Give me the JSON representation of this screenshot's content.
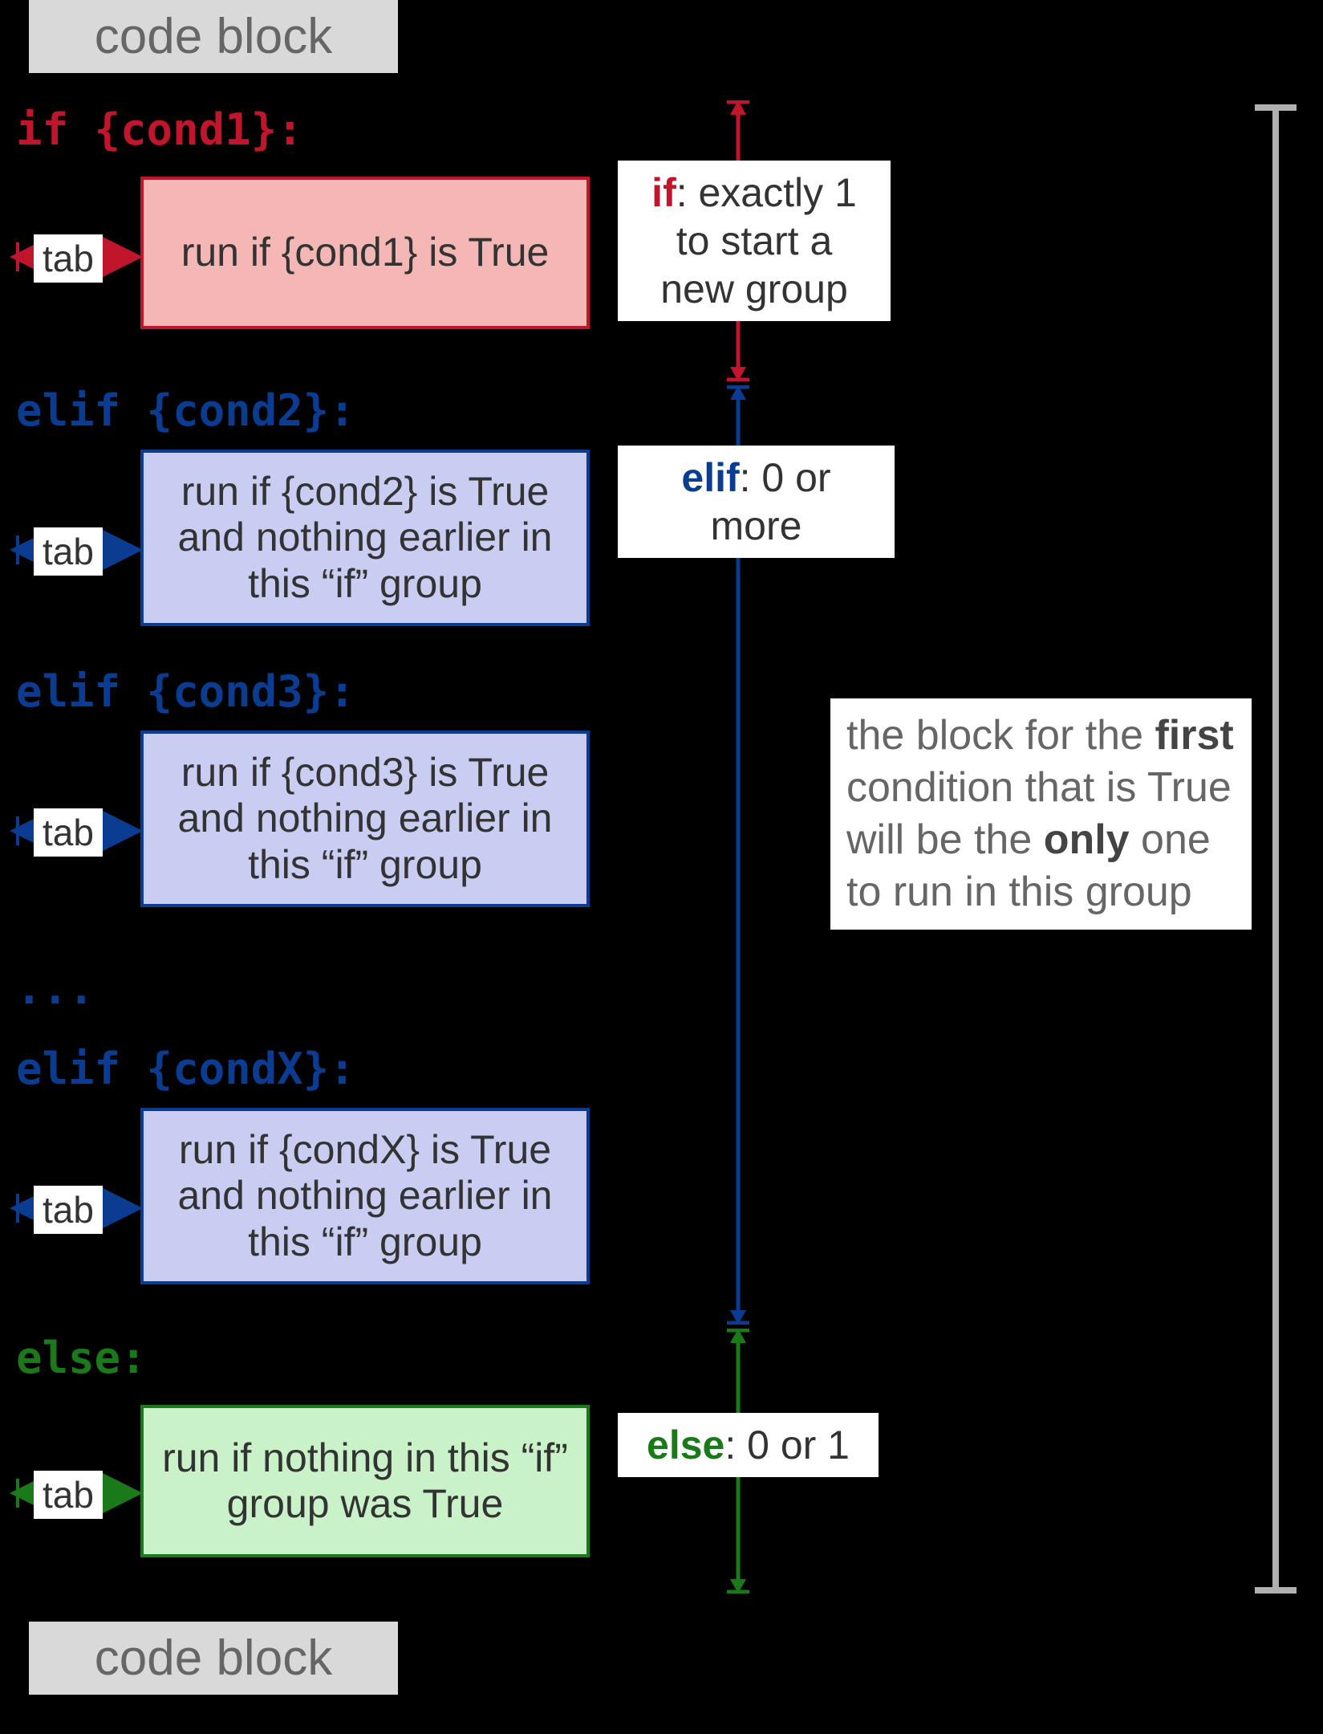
{
  "labels": {
    "code_block": "code block",
    "tab": "tab",
    "ellipsis": "..."
  },
  "if": {
    "keyword": "if {cond1}:",
    "run": "run if {cond1} is True",
    "annot_kw": "if",
    "annot_rest": ": exactly 1 to start a new group"
  },
  "elif": {
    "items": [
      {
        "keyword": "elif {cond2}:",
        "run": "run if {cond2} is True and nothing earlier in this “if” group"
      },
      {
        "keyword": "elif {cond3}:",
        "run": "run if {cond3} is True and nothing earlier in this “if” group"
      },
      {
        "keyword": "elif {condX}:",
        "run": "run if {condX} is True and nothing earlier in this “if” group"
      }
    ],
    "annot_kw": "elif",
    "annot_rest": ": 0 or more"
  },
  "else": {
    "keyword": "else:",
    "run": "run if nothing in this “if” group was True",
    "annot_kw": "else",
    "annot_rest": ": 0 or 1"
  },
  "summary": {
    "p1": "the block for the ",
    "s1": "first",
    "p2": " condition that is True will be the ",
    "s2": "only",
    "p3": " one to run in this group"
  },
  "colors": {
    "red": "#c0152a",
    "blue": "#0a3d91",
    "green": "#1a7a1a",
    "gray": "#b0b0b0"
  }
}
